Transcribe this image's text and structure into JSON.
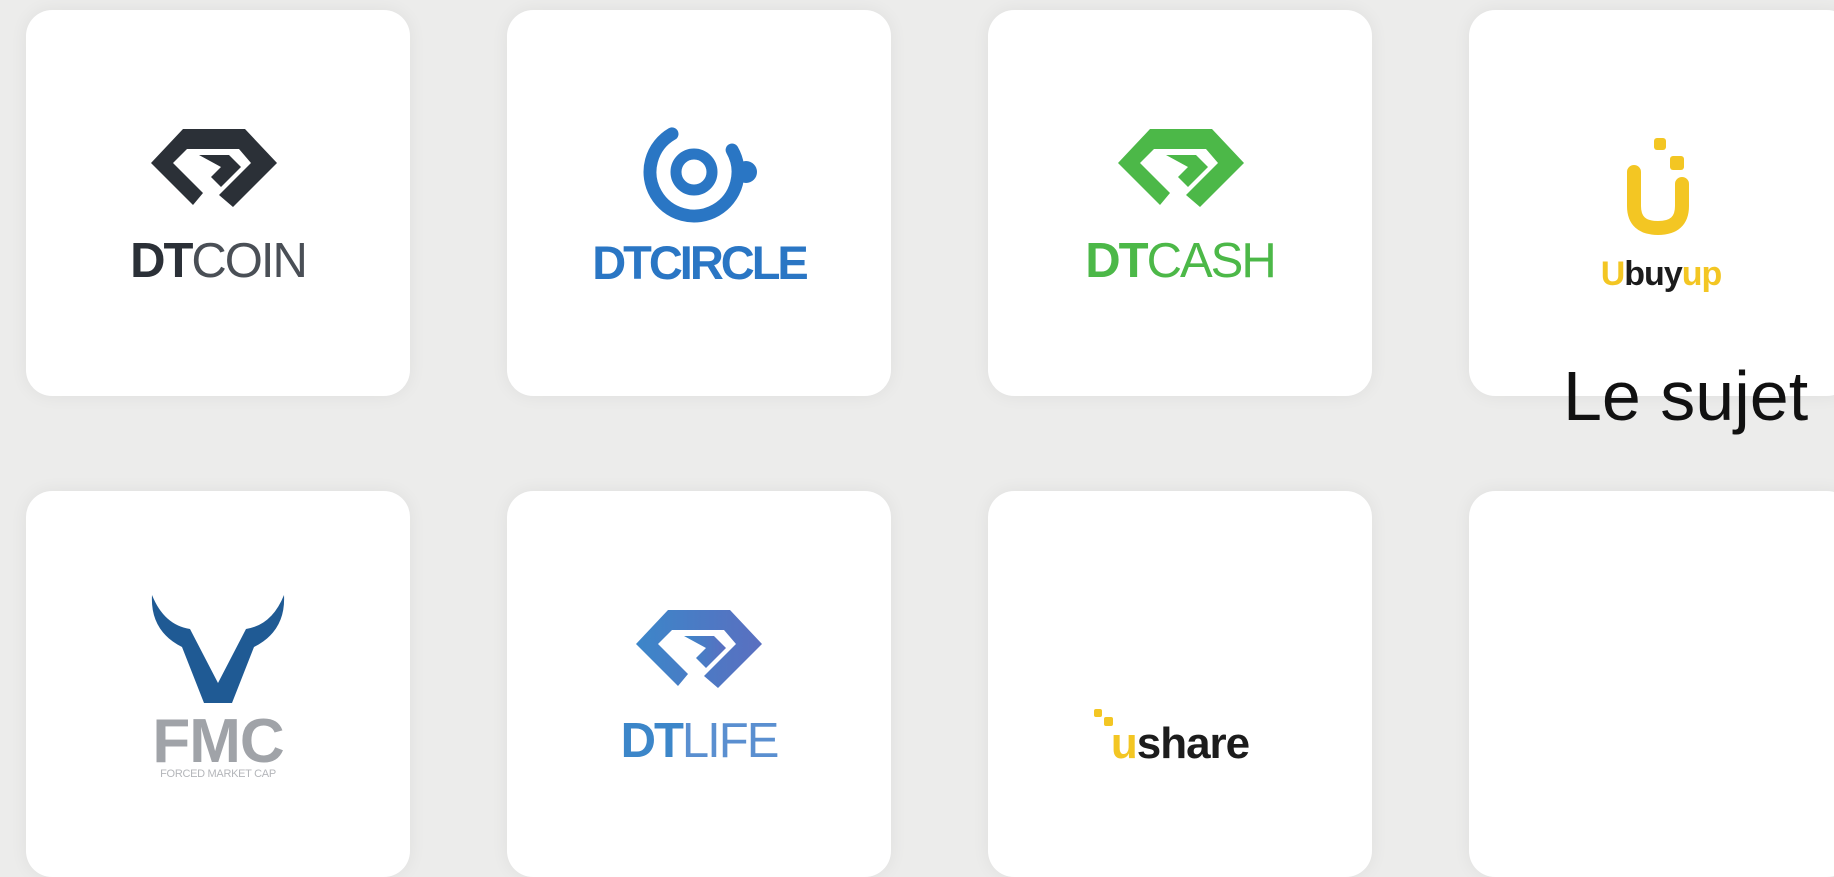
{
  "colors": {
    "background": "#ececeb",
    "dtcoin": "#2b3037",
    "dtcircle": "#2a76c4",
    "dtcash": "#4cb848",
    "ubuyup": "#f3c623",
    "fmc_blue": "#1f5a94",
    "fmc_grey": "#a0a3a8",
    "dtlife": "#3c86c9"
  },
  "tiles": [
    {
      "icon": "dtcoin-diamond-icon",
      "brand_bold": "DT",
      "brand_light": "COIN"
    },
    {
      "icon": "dtcircle-icon",
      "brand_bold": "DT",
      "brand_light": "CIRCLE"
    },
    {
      "icon": "dtcash-diamond-icon",
      "brand_bold": "DT",
      "brand_light": "CASH"
    },
    {
      "icon": "ubuyup-u-icon",
      "brand_u": "U",
      "brand_buy": "buy",
      "brand_up": "up"
    },
    {
      "icon": "fmc-bull-icon",
      "brand": "FMC",
      "tagline": "FORCED MARKET CAP"
    },
    {
      "icon": "dtlife-diamond-icon",
      "brand_bold": "DT",
      "brand_light": "LIFE"
    },
    {
      "icon": "ushare-u-icon",
      "brand_u": "u",
      "brand_rest": "share"
    },
    {
      "icon": "",
      "brand": ""
    }
  ],
  "caption": "Le sujet"
}
